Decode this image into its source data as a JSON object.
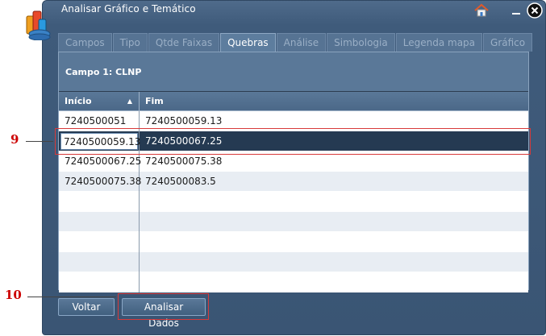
{
  "window": {
    "title": "Analisar Gráfico e Temático"
  },
  "icons": {
    "app": "database-chart-icon",
    "home": "home-icon",
    "minimize": "minimize-icon",
    "close": "close-icon"
  },
  "tabs": [
    {
      "label": "Campos"
    },
    {
      "label": "Tipo"
    },
    {
      "label": "Qtde Faixas"
    },
    {
      "label": "Quebras"
    },
    {
      "label": "Análise"
    },
    {
      "label": "Simbologia"
    },
    {
      "label": "Legenda mapa"
    },
    {
      "label": "Gráfico"
    }
  ],
  "active_tab": "Quebras",
  "panel": {
    "campo_label": "Campo 1: CLNP"
  },
  "grid": {
    "columns": [
      {
        "label": "Início",
        "sort": "ascending"
      },
      {
        "label": "Fim"
      }
    ],
    "rows": [
      {
        "inicio": "7240500051",
        "fim": "7240500059.13"
      },
      {
        "inicio": "7240500059.13",
        "fim": "7240500067.25",
        "selected": true,
        "editing": true
      },
      {
        "inicio": "7240500067.25",
        "fim": "7240500075.38"
      },
      {
        "inicio": "7240500075.38",
        "fim": "7240500083.5"
      },
      {
        "inicio": "",
        "fim": ""
      },
      {
        "inicio": "",
        "fim": ""
      },
      {
        "inicio": "",
        "fim": ""
      },
      {
        "inicio": "",
        "fim": ""
      },
      {
        "inicio": "",
        "fim": ""
      }
    ]
  },
  "buttons": {
    "voltar": "Voltar",
    "analisar": "Analisar Dados"
  },
  "callouts": {
    "row_marker": "9",
    "button_marker": "10",
    "color": "#cc0000"
  }
}
